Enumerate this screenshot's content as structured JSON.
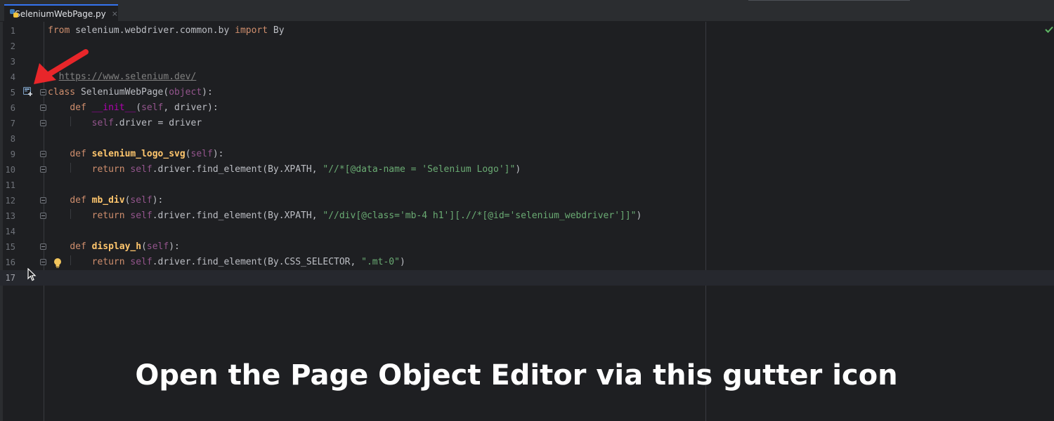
{
  "tab": {
    "file_name": "SeleniumWebPage.py",
    "close": "×"
  },
  "lines": [
    {
      "n": "1"
    },
    {
      "n": "2"
    },
    {
      "n": "3"
    },
    {
      "n": "4"
    },
    {
      "n": "5"
    },
    {
      "n": "6"
    },
    {
      "n": "7"
    },
    {
      "n": "8"
    },
    {
      "n": "9"
    },
    {
      "n": "10"
    },
    {
      "n": "11"
    },
    {
      "n": "12"
    },
    {
      "n": "13"
    },
    {
      "n": "14"
    },
    {
      "n": "15"
    },
    {
      "n": "16"
    },
    {
      "n": "17"
    }
  ],
  "code": {
    "l1": {
      "from": "from",
      "module": " selenium.webdriver.common.by ",
      "import": "import",
      "name": " By"
    },
    "l4": {
      "hash": "# ",
      "url": "https://www.selenium.dev/"
    },
    "l5": {
      "class": "class",
      "name": " SeleniumWebPage(",
      "base": "object",
      "end": "):"
    },
    "l6": {
      "indent": "    ",
      "def": "def",
      "name": " __init__",
      "open": "(",
      "self": "self",
      "rest": ", driver):"
    },
    "l7": {
      "indent": "        ",
      "self": "self",
      "rest": ".driver = driver"
    },
    "l9": {
      "indent": "    ",
      "def": "def",
      "name": " selenium_logo_svg",
      "open": "(",
      "self": "self",
      "end": "):"
    },
    "l10": {
      "indent": "        ",
      "ret": "return ",
      "self": "self",
      "call": ".driver.find_element(By.XPATH, ",
      "str": "\"//*[@data-name = 'Selenium Logo']\"",
      "end": ")"
    },
    "l12": {
      "indent": "    ",
      "def": "def",
      "name": " mb_div",
      "open": "(",
      "self": "self",
      "end": "):"
    },
    "l13": {
      "indent": "        ",
      "ret": "return ",
      "self": "self",
      "call": ".driver.find_element(By.XPATH, ",
      "str": "\"//div[@class='mb-4 h1'][.//*[@id='selenium_webdriver']]\"",
      "end": ")"
    },
    "l15": {
      "indent": "    ",
      "def": "def",
      "name": " display_h",
      "open": "(",
      "self": "self",
      "end": "):"
    },
    "l16": {
      "indent": "        ",
      "ret": "return ",
      "self": "self",
      "call": ".driver.find_element(By.CSS_SELECTOR, ",
      "str": "\".mt-0\"",
      "end": ")"
    }
  },
  "caption": "Open the Page Object Editor via this gutter icon",
  "colors": {
    "accent": "#3574f0",
    "keyword": "#cf8e6d",
    "string": "#6aab73",
    "arrow": "#e8262a"
  },
  "icons": [
    "python-file-icon",
    "page-object-editor-gutter-icon",
    "intention-bulb-icon",
    "mouse-cursor-icon",
    "red-arrow",
    "inspection-ok-check-icon"
  ]
}
